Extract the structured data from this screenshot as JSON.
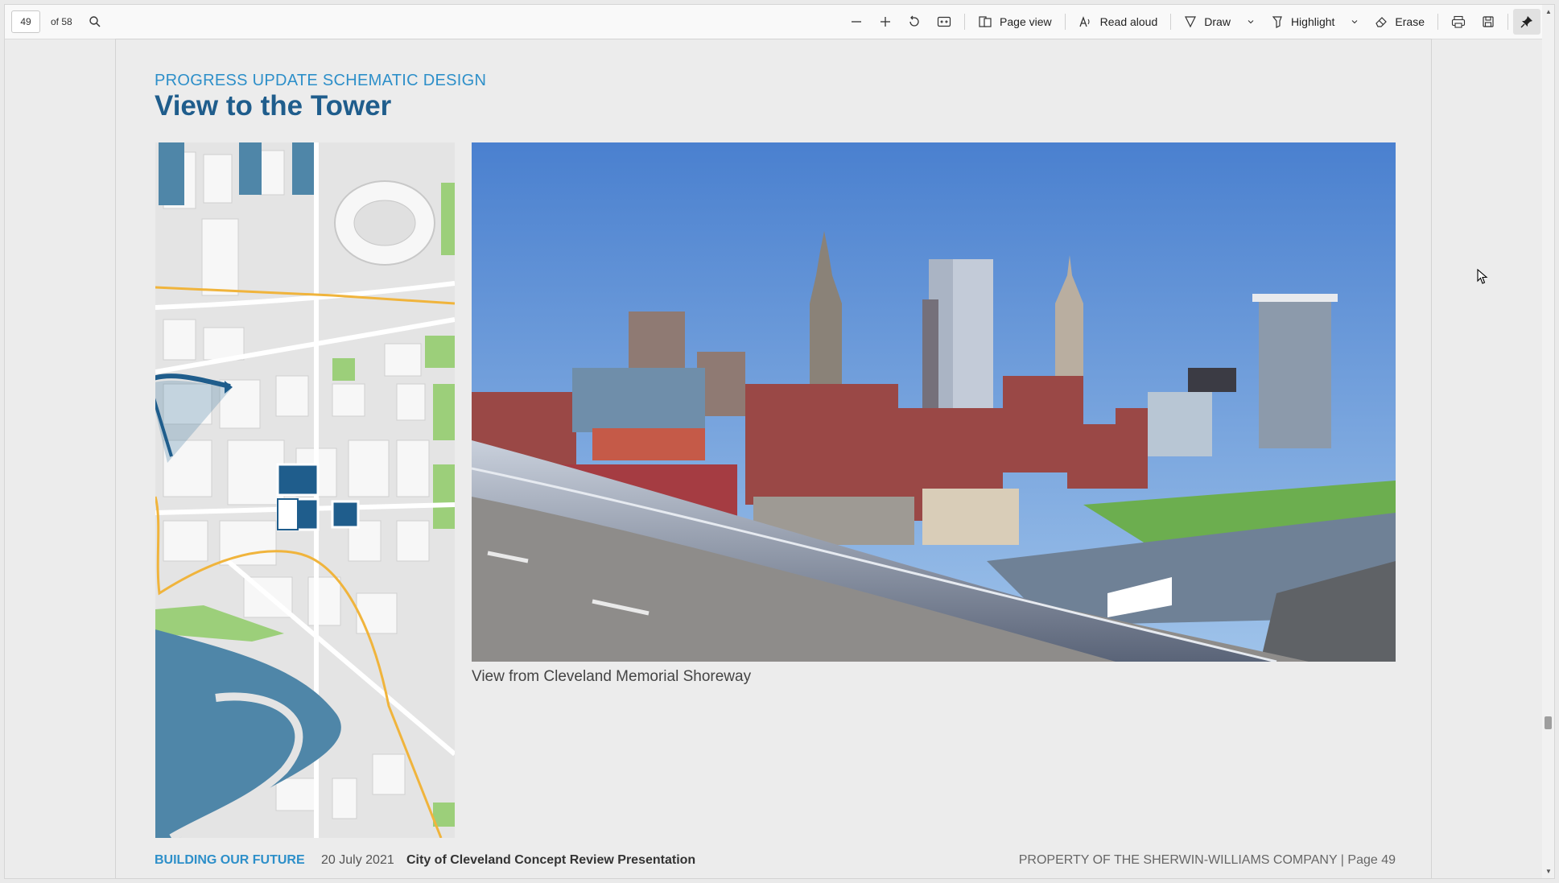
{
  "toolbar": {
    "page_number": "49",
    "page_count": "of 58",
    "page_view": "Page view",
    "read_aloud": "Read aloud",
    "draw": "Draw",
    "highlight": "Highlight",
    "erase": "Erase"
  },
  "document": {
    "subtitle": "PROGRESS UPDATE SCHEMATIC DESIGN",
    "title": "View to the Tower",
    "caption": "View from Cleveland Memorial Shoreway",
    "footer": {
      "brand": "BUILDING OUR FUTURE",
      "date": "20 July 2021",
      "presentation": "City of Cleveland Concept Review Presentation",
      "property": "PROPERTY  OF THE SHERWIN-WILLIAMS COMPANY  |  Page 49"
    }
  },
  "colors": {
    "accent_blue": "#2d8fc9",
    "title_blue": "#1f5d8c",
    "map_water": "#4f86a8",
    "map_route": "#f0b43c",
    "map_park": "#9ccf7a"
  }
}
